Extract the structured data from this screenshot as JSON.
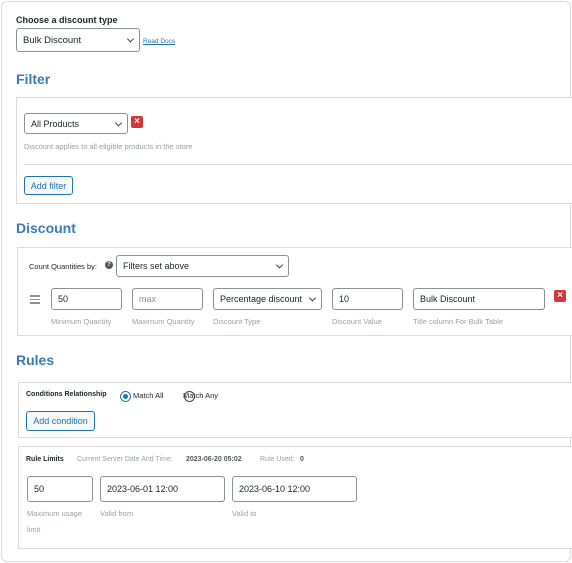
{
  "discount_type": {
    "label": "Choose a discount type",
    "selected": "Bulk Discount",
    "docs_link": "Read Docs"
  },
  "filter": {
    "title": "Filter",
    "selected": "All Products",
    "help": "Discount applies to all eligible products in the store",
    "add_button": "Add filter",
    "remove_glyph": "×"
  },
  "discount": {
    "title": "Discount",
    "count_label": "Count Quantities by:",
    "count_help_glyph": "?",
    "count_selected": "Filters set above",
    "row": {
      "min_value": "50",
      "min_label": "Minimum Quantity",
      "max_placeholder": "max",
      "max_label": "Maximum Quantity",
      "type_selected": "Percentage discount",
      "type_label": "Discount Type",
      "value": "10",
      "value_label": "Discount Value",
      "title_value": "Bulk Discount",
      "title_label": "Title column For Bulk Table",
      "remove_glyph": "×"
    }
  },
  "rules": {
    "title": "Rules",
    "relationship_label": "Conditions Relationship",
    "match_all": "Match All",
    "match_any": "Match Any",
    "match_selected": "all",
    "add_condition": "Add condition"
  },
  "rule_limits": {
    "label": "Rule Limits",
    "server_time_label": "Current Server Date And Time:",
    "server_time_value": "2023-06-20 05:02",
    "rule_used_label": "Rule Used:",
    "rule_used_value": "0",
    "max_usage_value": "50",
    "max_usage_label_1": "Maximum usage",
    "max_usage_label_2": "limit",
    "valid_from_value": "2023-06-01 12:00",
    "valid_from_label": "Valid from",
    "valid_to_value": "2023-06-10 12:00",
    "valid_to_label": "Valid to"
  },
  "colors": {
    "accent": "#2271b1",
    "section_title": "#3b7ab5",
    "danger": "#d63638"
  }
}
